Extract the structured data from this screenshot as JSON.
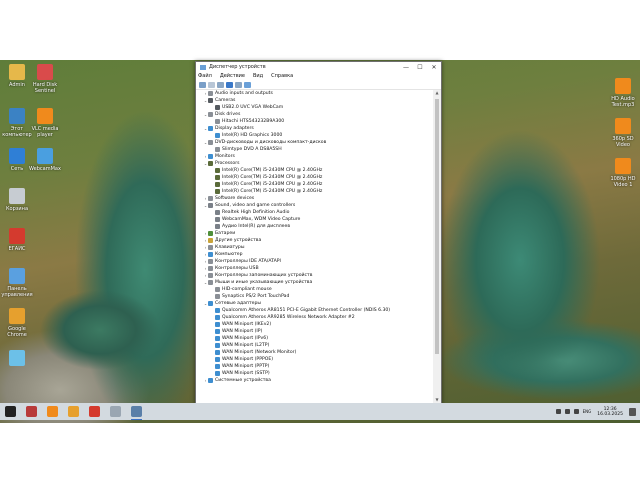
{
  "desktop": {
    "left_icons": [
      {
        "name": "admin-folder-icon",
        "label": "Admin",
        "color": "#e6b84a"
      },
      {
        "name": "computer-icon",
        "label": "Этот компьютер",
        "color": "#3b82c4"
      },
      {
        "name": "network-icon",
        "label": "Сеть",
        "color": "#2f7fd6"
      },
      {
        "name": "recycle-bin-icon",
        "label": "Корзина",
        "color": "#c7ccd2"
      },
      {
        "name": "app-64-icon",
        "label": "ЕГАИС",
        "color": "#d43a2e"
      },
      {
        "name": "control-panel-icon",
        "label": "Панель управления",
        "color": "#5aa0e0"
      },
      {
        "name": "chrome-icon",
        "label": "Google Chrome",
        "color": "#e6a02e"
      },
      {
        "name": "screenshot-icon",
        "label": "",
        "color": "#6cc0e8"
      }
    ],
    "second_column": [
      {
        "name": "hard-disk-sentinel-icon",
        "label": "Hard Disk Sentinel",
        "color": "#d94b4b"
      },
      {
        "name": "vlc-icon",
        "label": "VLC media player",
        "color": "#f08a1c"
      },
      {
        "name": "webcammax-icon",
        "label": "WebcamMax",
        "color": "#4a9fe0"
      }
    ],
    "right_icons": [
      {
        "name": "vlc-file-icon",
        "label": "HD Audio Test.mp3",
        "color": "#f08a1c"
      },
      {
        "name": "video-360p-icon",
        "label": "360p SD Video",
        "color": "#f08a1c"
      },
      {
        "name": "video-1080p-icon",
        "label": "1080p HD Video 1",
        "color": "#f08a1c"
      }
    ]
  },
  "window": {
    "title": "Диспетчер устройств",
    "controls": {
      "minimize": "—",
      "maximize": "☐",
      "close": "✕"
    },
    "menu": [
      "Файл",
      "Действие",
      "Вид",
      "Справка"
    ],
    "toolbar_icons": [
      {
        "name": "back-icon",
        "color": "#7a9fc8"
      },
      {
        "name": "forward-icon",
        "color": "#b8c6d6"
      },
      {
        "name": "properties-icon",
        "color": "#8aa6c4"
      },
      {
        "name": "help-icon",
        "color": "#3a78c8"
      },
      {
        "name": "update-driver-icon",
        "color": "#8aa6c4"
      },
      {
        "name": "scan-hardware-icon",
        "color": "#6aa0d8"
      }
    ],
    "tree": [
      {
        "level": 0,
        "chev": "›",
        "text": "Audio inputs and outputs",
        "icon": "#8a8f96"
      },
      {
        "level": 0,
        "chev": "⌄",
        "text": "Cameras",
        "icon": "#555a60"
      },
      {
        "level": 1,
        "chev": "",
        "text": "USB2.0 UVC VGA WebCam",
        "icon": "#555a60"
      },
      {
        "level": 0,
        "chev": "⌄",
        "text": "Disk drives",
        "icon": "#8a8f96"
      },
      {
        "level": 1,
        "chev": "",
        "text": "Hitachi HTS543232B9A300",
        "icon": "#8a8f96"
      },
      {
        "level": 0,
        "chev": "⌄",
        "text": "Display adapters",
        "icon": "#3e8ed0"
      },
      {
        "level": 1,
        "chev": "",
        "text": "Intel(R) HD Graphics 3000",
        "icon": "#3e8ed0"
      },
      {
        "level": 0,
        "chev": "⌄",
        "text": "DVD-дисководы и дисководы компакт-дисков",
        "icon": "#8a8f96"
      },
      {
        "level": 1,
        "chev": "",
        "text": "Slimtype DVD A  DS8A5SH",
        "icon": "#8a8f96"
      },
      {
        "level": 0,
        "chev": "›",
        "text": "Monitors",
        "icon": "#3e8ed0"
      },
      {
        "level": 0,
        "chev": "⌄",
        "text": "Processors",
        "icon": "#5b6b3a"
      },
      {
        "level": 1,
        "chev": "",
        "text": "Intel(R) Core(TM) i5-2430M CPU @ 2.40GHz",
        "icon": "#5b6b3a"
      },
      {
        "level": 1,
        "chev": "",
        "text": "Intel(R) Core(TM) i5-2430M CPU @ 2.40GHz",
        "icon": "#5b6b3a"
      },
      {
        "level": 1,
        "chev": "",
        "text": "Intel(R) Core(TM) i5-2430M CPU @ 2.40GHz",
        "icon": "#5b6b3a"
      },
      {
        "level": 1,
        "chev": "",
        "text": "Intel(R) Core(TM) i5-2430M CPU @ 2.40GHz",
        "icon": "#5b6b3a"
      },
      {
        "level": 0,
        "chev": "›",
        "text": "Software devices",
        "icon": "#8a8f96"
      },
      {
        "level": 0,
        "chev": "⌄",
        "text": "Sound, video and game controllers",
        "icon": "#7a8088"
      },
      {
        "level": 1,
        "chev": "",
        "text": "Realtek High Definition Audio",
        "icon": "#7a8088"
      },
      {
        "level": 1,
        "chev": "",
        "text": "WebcamMax, WDM Video Capture",
        "icon": "#7a8088"
      },
      {
        "level": 1,
        "chev": "",
        "text": "Аудио Intel(R) для дисплеев",
        "icon": "#7a8088"
      },
      {
        "level": 0,
        "chev": "›",
        "text": "Батареи",
        "icon": "#4f8f3a"
      },
      {
        "level": 0,
        "chev": "›",
        "text": "Другие устройства",
        "icon": "#c9a43a"
      },
      {
        "level": 0,
        "chev": "›",
        "text": "Клавиатуры",
        "icon": "#8a8f96"
      },
      {
        "level": 0,
        "chev": "›",
        "text": "Компьютер",
        "icon": "#3e8ed0"
      },
      {
        "level": 0,
        "chev": "›",
        "text": "Контроллеры IDE ATA/ATAPI",
        "icon": "#8a8f96"
      },
      {
        "level": 0,
        "chev": "›",
        "text": "Контроллеры USB",
        "icon": "#8a8f96"
      },
      {
        "level": 0,
        "chev": "›",
        "text": "Контроллеры запоминающих устройств",
        "icon": "#8a8f96"
      },
      {
        "level": 0,
        "chev": "⌄",
        "text": "Мыши и иные указывающие устройства",
        "icon": "#8a8f96"
      },
      {
        "level": 1,
        "chev": "",
        "text": "HID-compliant mouse",
        "icon": "#8a8f96"
      },
      {
        "level": 1,
        "chev": "",
        "text": "Synaptics PS/2 Port TouchPad",
        "icon": "#8a8f96"
      },
      {
        "level": 0,
        "chev": "⌄",
        "text": "Сетевые адаптеры",
        "icon": "#3e8ed0"
      },
      {
        "level": 1,
        "chev": "",
        "text": "Qualcomm Atheros AR8151 PCI-E Gigabit Ethernet Controller (NDIS 6.30)",
        "icon": "#3e8ed0"
      },
      {
        "level": 1,
        "chev": "",
        "text": "Qualcomm Atheros AR9285 Wireless Network Adapter #2",
        "icon": "#3e8ed0"
      },
      {
        "level": 1,
        "chev": "",
        "text": "WAN Miniport (IKEv2)",
        "icon": "#3e8ed0"
      },
      {
        "level": 1,
        "chev": "",
        "text": "WAN Miniport (IP)",
        "icon": "#3e8ed0"
      },
      {
        "level": 1,
        "chev": "",
        "text": "WAN Miniport (IPv6)",
        "icon": "#3e8ed0"
      },
      {
        "level": 1,
        "chev": "",
        "text": "WAN Miniport (L2TP)",
        "icon": "#3e8ed0"
      },
      {
        "level": 1,
        "chev": "",
        "text": "WAN Miniport (Network Monitor)",
        "icon": "#3e8ed0"
      },
      {
        "level": 1,
        "chev": "",
        "text": "WAN Miniport (PPPOE)",
        "icon": "#3e8ed0"
      },
      {
        "level": 1,
        "chev": "",
        "text": "WAN Miniport (PPTP)",
        "icon": "#3e8ed0"
      },
      {
        "level": 1,
        "chev": "",
        "text": "WAN Miniport (SSTP)",
        "icon": "#3e8ed0"
      },
      {
        "level": 0,
        "chev": "›",
        "text": "Системные устройства",
        "icon": "#3e8ed0"
      }
    ],
    "scroll": {
      "up": "▲",
      "down": "▼"
    }
  },
  "taskbar": {
    "pinned": [
      {
        "name": "start-icon",
        "color": "#222222",
        "active": false
      },
      {
        "name": "hard-disk-sentinel-taskbar-icon",
        "color": "#b83a3a",
        "active": false
      },
      {
        "name": "vlc-taskbar-icon",
        "color": "#f08a1c",
        "active": false
      },
      {
        "name": "chrome-taskbar-icon",
        "color": "#e6a02e",
        "active": false
      },
      {
        "name": "app-64-taskbar-icon",
        "color": "#d43a2e",
        "active": false
      },
      {
        "name": "paint-taskbar-icon",
        "color": "#9aa6b2",
        "active": false
      },
      {
        "name": "device-manager-taskbar-icon",
        "color": "#5a7fa8",
        "active": true
      }
    ],
    "tray_icons": [
      {
        "name": "network-tray-icon",
        "color": "#444444"
      },
      {
        "name": "battery-tray-icon",
        "color": "#444444"
      },
      {
        "name": "volume-tray-icon",
        "color": "#444444"
      }
    ],
    "language": "ENG",
    "time": "12:36",
    "date": "16.03.2025"
  }
}
